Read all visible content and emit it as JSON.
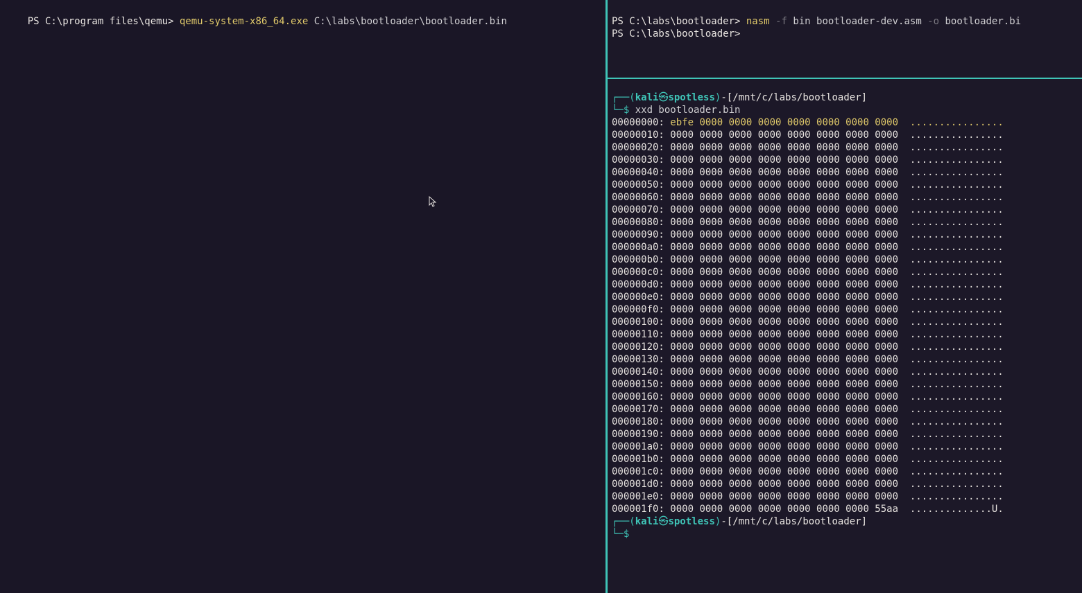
{
  "left": {
    "prompt": "PS C:\\program files\\qemu> ",
    "command": "qemu-system-x86_64.exe",
    "arg": " C:\\labs\\bootloader\\bootloader.bin"
  },
  "rightTop": {
    "prompt1": "PS C:\\labs\\bootloader> ",
    "cmd1": "nasm",
    "flag1": " -f",
    "arg1a": " bin bootloader-dev.asm",
    "flag2": " -o",
    "arg1b": " bootloader.bi",
    "prompt2": "PS C:\\labs\\bootloader>"
  },
  "kali": {
    "user": "kali",
    "host": "spotless",
    "path": "/mnt/c/labs/bootloader",
    "cmd": "xxd bootloader.bin"
  },
  "hex": {
    "first_offset": "00000000",
    "first_bytes": "ebfe 0000 0000 0000 0000 0000 0000 0000",
    "first_ascii": "................",
    "zero_bytes": "0000 0000 0000 0000 0000 0000 0000 0000",
    "zero_ascii": "................",
    "last_offset": "000001f0",
    "last_bytes": "0000 0000 0000 0000 0000 0000 0000 55aa",
    "last_ascii": "..............U.",
    "offsets": [
      "00000010",
      "00000020",
      "00000030",
      "00000040",
      "00000050",
      "00000060",
      "00000070",
      "00000080",
      "00000090",
      "000000a0",
      "000000b0",
      "000000c0",
      "000000d0",
      "000000e0",
      "000000f0",
      "00000100",
      "00000110",
      "00000120",
      "00000130",
      "00000140",
      "00000150",
      "00000160",
      "00000170",
      "00000180",
      "00000190",
      "000001a0",
      "000001b0",
      "000001c0",
      "000001d0",
      "000001e0"
    ]
  }
}
